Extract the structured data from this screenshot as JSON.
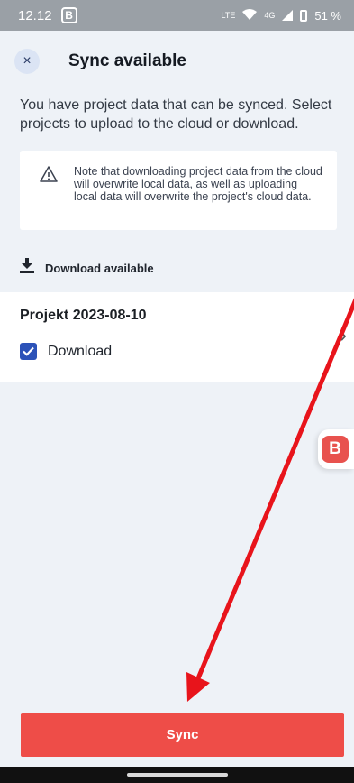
{
  "status_bar": {
    "time": "12.12",
    "app_chip": "B",
    "network": "LTE",
    "signal_label": "4G",
    "battery": "51 %"
  },
  "header": {
    "close_icon": "×",
    "title": "Sync available"
  },
  "intro_text": "You have project data that can be synced. Select projects to upload to the cloud or download.",
  "note": {
    "icon": "warning-icon",
    "text": "Note that downloading project data from the cloud will overwrite local data, as well as uploading local data will overwrite the project's cloud data."
  },
  "download_section": {
    "icon": "download-icon",
    "label": "Download available"
  },
  "project": {
    "name": "Projekt 2023-08-10",
    "checkbox_label": "Download",
    "checked": true,
    "chevron": "›"
  },
  "floating_badge": "B",
  "sync_button_label": "Sync",
  "colors": {
    "accent": "#ee4d48",
    "checkbox": "#2c52b8",
    "background": "#eef2f7",
    "annotation_arrow": "#e8141b"
  }
}
